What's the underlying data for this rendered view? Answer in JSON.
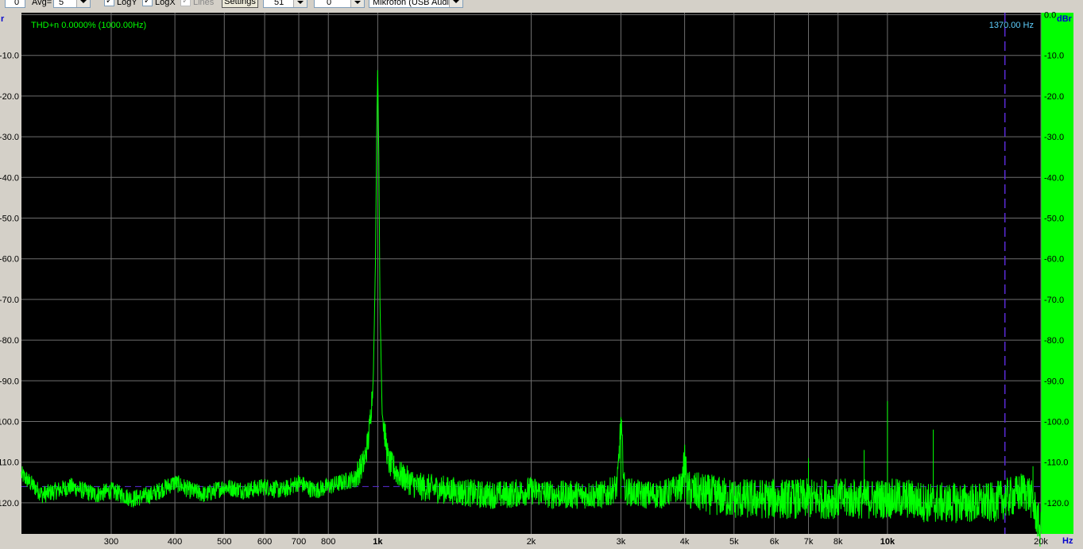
{
  "toolbar": {
    "field0_value": "0",
    "avg_label": "Avg=",
    "avg_value": "5",
    "logy_label": "LogY",
    "logx_label": "LogX",
    "lines_label": "Lines",
    "settings_label": "Settings",
    "spin1_value": "51",
    "spin2_value": "0",
    "device_value": "Mikrofon (USB Audi"
  },
  "plot": {
    "left_unit_label": "r",
    "right_unit_label": "dBr",
    "x_unit_label": "Hz",
    "thd_text": "THD+n 0.0000% (1000.00Hz)",
    "cursor_text": "1370.00 Hz",
    "trace_color": "#00ff00",
    "grid_color": "#6e6e6e",
    "cursor_color": "#5a2bd6",
    "info_color": "#5fd0ff"
  },
  "chart_data": {
    "type": "line",
    "title": "",
    "xlabel": "Hz",
    "ylabel": "dBr",
    "x_scale": "log",
    "xlim": [
      200,
      20000
    ],
    "ylim": [
      -128,
      0
    ],
    "grid": true,
    "x_ticks": [
      300,
      400,
      500,
      600,
      700,
      800,
      1000,
      2000,
      3000,
      4000,
      5000,
      6000,
      7000,
      8000,
      10000,
      20000
    ],
    "x_tick_labels": [
      "300",
      "400",
      "500",
      "600",
      "700",
      "800",
      "1k",
      "2k",
      "3k",
      "4k",
      "5k",
      "6k",
      "7k",
      "8k",
      "10k",
      "20k"
    ],
    "y_ticks": [
      0,
      -10,
      -20,
      -30,
      -40,
      -50,
      -60,
      -70,
      -80,
      -90,
      -100,
      -110,
      -120
    ],
    "y_tick_labels_left": [
      "",
      "-10.0",
      "-20.0",
      "-30.0",
      "-40.0",
      "-50.0",
      "-60.0",
      "-70.0",
      "-80.0",
      "-90.0",
      "-100.0",
      "-110.0",
      "-120.0"
    ],
    "y_tick_labels_right": [
      "0.0",
      "-10.0",
      "-20.0",
      "-30.0",
      "-40.0",
      "-50.0",
      "-60.0",
      "-70.0",
      "-80.0",
      "-90.0",
      "-100.0",
      "-110.0",
      "-120.0"
    ],
    "cursor_x_hz": 17000,
    "reference_level_db": -116,
    "series": [
      {
        "color": "#00ff00",
        "x": [
          200,
          220,
          250,
          280,
          300,
          330,
          360,
          400,
          430,
          460,
          500,
          550,
          600,
          650,
          700,
          750,
          800,
          850,
          900,
          940,
          960,
          980,
          990,
          995,
          1000,
          1005,
          1010,
          1020,
          1050,
          1100,
          1200,
          1400,
          1600,
          1800,
          2000,
          2200,
          2500,
          2800,
          2950,
          3000,
          3050,
          3300,
          3600,
          3950,
          4000,
          4050,
          4500,
          5000,
          5500,
          6000,
          6500,
          7000,
          7500,
          8000,
          8500,
          9000,
          10000,
          11000,
          12000,
          12500,
          13000,
          14000,
          15000,
          16000,
          17000,
          18000,
          18500,
          19000,
          19500,
          20000
        ],
        "y": [
          -113,
          -118,
          -116,
          -118,
          -117,
          -119,
          -118,
          -115,
          -117,
          -118,
          -116,
          -117,
          -116,
          -117,
          -115,
          -117,
          -116,
          -115,
          -114,
          -110,
          -104,
          -90,
          -60,
          -30,
          -13,
          -35,
          -70,
          -98,
          -110,
          -113,
          -116,
          -117,
          -118,
          -118,
          -117,
          -118,
          -118,
          -118,
          -116,
          -100,
          -117,
          -118,
          -118,
          -116,
          -109,
          -117,
          -118,
          -119,
          -119,
          -119,
          -119,
          -119,
          -119,
          -119,
          -119,
          -119,
          -119,
          -119,
          -120,
          -120,
          -120,
          -120,
          -120,
          -120,
          -119,
          -118,
          -117,
          -118,
          -122,
          -127
        ]
      }
    ],
    "spikes": [
      {
        "x": 3000,
        "y": -100
      },
      {
        "x": 4000,
        "y": -109
      },
      {
        "x": 7000,
        "y": -109
      },
      {
        "x": 9000,
        "y": -107
      },
      {
        "x": 10000,
        "y": -95
      },
      {
        "x": 12300,
        "y": -102
      },
      {
        "x": 19300,
        "y": -111
      }
    ]
  }
}
